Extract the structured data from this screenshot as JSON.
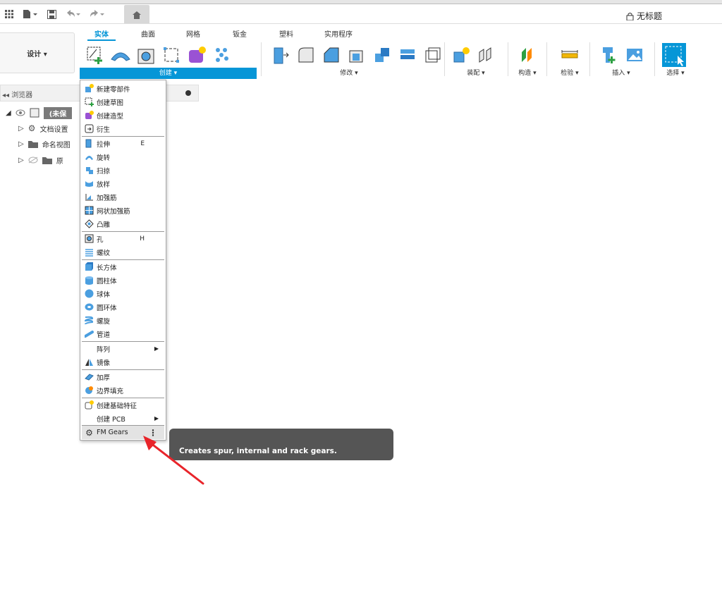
{
  "app": {
    "document_title": "无标题"
  },
  "ribbon": {
    "design_label": "设计 ▾",
    "tabs": [
      "实体",
      "曲面",
      "网格",
      "钣金",
      "塑料",
      "实用程序"
    ],
    "groups": {
      "create": "创建 ▾",
      "modify": "修改 ▾",
      "assemble": "装配 ▾",
      "construct": "构造 ▾",
      "inspect": "检验 ▾",
      "insert": "插入 ▾",
      "select": "选择 ▾"
    }
  },
  "browser": {
    "title": "浏览器",
    "items": [
      {
        "label": "(未保"
      },
      {
        "label": "文档设置"
      },
      {
        "label": "命名视图"
      },
      {
        "label": "原"
      }
    ]
  },
  "create_menu": {
    "items": [
      {
        "label": "新建零部件",
        "icon": "new-component-icon"
      },
      {
        "label": "创建草图",
        "icon": "create-sketch-icon"
      },
      {
        "label": "创建造型",
        "icon": "create-form-icon"
      },
      {
        "label": "衍生",
        "icon": "derive-icon"
      },
      {
        "label": "拉伸",
        "shortcut": "E",
        "icon": "extrude-icon"
      },
      {
        "label": "旋转",
        "icon": "revolve-icon"
      },
      {
        "label": "扫掠",
        "icon": "sweep-icon"
      },
      {
        "label": "放样",
        "icon": "loft-icon"
      },
      {
        "label": "加强筋",
        "icon": "rib-icon"
      },
      {
        "label": "网状加强筋",
        "icon": "web-icon"
      },
      {
        "label": "凸雕",
        "icon": "emboss-icon"
      },
      {
        "label": "孔",
        "shortcut": "H",
        "icon": "hole-icon"
      },
      {
        "label": "螺纹",
        "icon": "thread-icon"
      },
      {
        "label": "长方体",
        "icon": "box-icon"
      },
      {
        "label": "圆柱体",
        "icon": "cylinder-icon"
      },
      {
        "label": "球体",
        "icon": "sphere-icon"
      },
      {
        "label": "圆环体",
        "icon": "torus-icon"
      },
      {
        "label": "螺旋",
        "icon": "coil-icon"
      },
      {
        "label": "管道",
        "icon": "pipe-icon"
      },
      {
        "label": "阵列",
        "icon": ""
      },
      {
        "label": "镜像",
        "icon": "mirror-icon"
      },
      {
        "label": "加厚",
        "icon": "thicken-icon"
      },
      {
        "label": "边界填充",
        "icon": "boundary-fill-icon"
      },
      {
        "label": "创建基础特征",
        "icon": "base-feature-icon"
      },
      {
        "label": "创建 PCB",
        "icon": ""
      },
      {
        "label": "FM Gears",
        "icon": "gear-icon"
      }
    ]
  },
  "tooltip": {
    "text": "Creates spur, internal and rack gears."
  },
  "colors": {
    "accent": "#0696d7",
    "tooltip_bg": "#555555",
    "arrow": "#e8242a"
  }
}
